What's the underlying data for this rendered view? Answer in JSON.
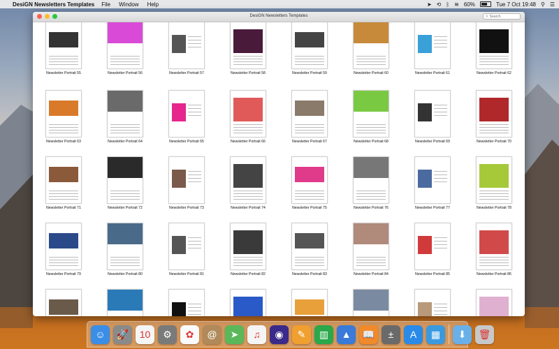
{
  "menubar": {
    "apple": "",
    "app_name": "DesiGN Newsletters Templates",
    "menus": [
      "File",
      "Window",
      "Help"
    ],
    "battery": "60%",
    "clock": "Tue 7 Oct  19:48"
  },
  "window": {
    "title": "DesiGN Newsletters Templates",
    "search_placeholder": "Search"
  },
  "templates": [
    {
      "label": "Newsletter Portrait 55",
      "accent": "#333333"
    },
    {
      "label": "Newsletter Portrait 56",
      "accent": "#d94bd6"
    },
    {
      "label": "Newsletter Portrait 57",
      "accent": "#555555"
    },
    {
      "label": "Newsletter Portrait 58",
      "accent": "#4a1a3a"
    },
    {
      "label": "Newsletter Portrait 59",
      "accent": "#444444"
    },
    {
      "label": "Newsletter Portrait 60",
      "accent": "#c78a3a"
    },
    {
      "label": "Newsletter Portrait 61",
      "accent": "#3aa0d8"
    },
    {
      "label": "Newsletter Portrait 62",
      "accent": "#111111"
    },
    {
      "label": "Newsletter Portrait 63",
      "accent": "#d97a2a"
    },
    {
      "label": "Newsletter Portrait 64",
      "accent": "#6a6a6a"
    },
    {
      "label": "Newsletter Portrait 65",
      "accent": "#e6268c"
    },
    {
      "label": "Newsletter Portrait 66",
      "accent": "#e05a5a"
    },
    {
      "label": "Newsletter Portrait 67",
      "accent": "#8a7a6a"
    },
    {
      "label": "Newsletter Portrait 68",
      "accent": "#7ac943"
    },
    {
      "label": "Newsletter Portrait 69",
      "accent": "#333333"
    },
    {
      "label": "Newsletter Portrait 70",
      "accent": "#b0282a"
    },
    {
      "label": "Newsletter Portrait 71",
      "accent": "#8a5a3a"
    },
    {
      "label": "Newsletter Portrait 72",
      "accent": "#2a2a2a"
    },
    {
      "label": "Newsletter Portrait 73",
      "accent": "#7a5a4a"
    },
    {
      "label": "Newsletter Portrait 74",
      "accent": "#444444"
    },
    {
      "label": "Newsletter Portrait 75",
      "accent": "#e03a8a"
    },
    {
      "label": "Newsletter Portrait 76",
      "accent": "#777777"
    },
    {
      "label": "Newsletter Portrait 77",
      "accent": "#4a6aa0"
    },
    {
      "label": "Newsletter Portrait 78",
      "accent": "#a6c93a"
    },
    {
      "label": "Newsletter Portrait 79",
      "accent": "#2a4a8a"
    },
    {
      "label": "Newsletter Portrait 80",
      "accent": "#4a6a8a"
    },
    {
      "label": "Newsletter Portrait 81",
      "accent": "#555555"
    },
    {
      "label": "Newsletter Portrait 82",
      "accent": "#3a3a3a"
    },
    {
      "label": "Newsletter Portrait 83",
      "accent": "#555555"
    },
    {
      "label": "Newsletter Portrait 84",
      "accent": "#b08a7a"
    },
    {
      "label": "Newsletter Portrait 85",
      "accent": "#d03a3a"
    },
    {
      "label": "Newsletter Portrait 86",
      "accent": "#d04a4a"
    },
    {
      "label": "",
      "accent": "#6a5a4a"
    },
    {
      "label": "",
      "accent": "#2a7ab8"
    },
    {
      "label": "",
      "accent": "#111111"
    },
    {
      "label": "",
      "accent": "#2a5ac8"
    },
    {
      "label": "",
      "accent": "#e8a03a"
    },
    {
      "label": "",
      "accent": "#7a8aa0"
    },
    {
      "label": "",
      "accent": "#b89a7a"
    },
    {
      "label": "",
      "accent": "#e0b0d0"
    }
  ],
  "dock": [
    {
      "name": "finder-icon",
      "glyph": "☺",
      "bg": "#3a8ee6"
    },
    {
      "name": "launchpad-icon",
      "glyph": "🚀",
      "bg": "#8a8a8a"
    },
    {
      "name": "calendar-icon",
      "glyph": "10",
      "bg": "#f5f5f5"
    },
    {
      "name": "system-preferences-icon",
      "glyph": "⚙",
      "bg": "#7a7a7a"
    },
    {
      "name": "photos-icon",
      "glyph": "✿",
      "bg": "#fafafa"
    },
    {
      "name": "contacts-icon",
      "glyph": "@",
      "bg": "#b08a5a"
    },
    {
      "name": "maps-icon",
      "glyph": "➤",
      "bg": "#5ab85a"
    },
    {
      "name": "itunes-icon",
      "glyph": "♫",
      "bg": "#f5f5f5"
    },
    {
      "name": "siri-icon",
      "glyph": "◉",
      "bg": "#3a2a8a"
    },
    {
      "name": "pages-icon",
      "glyph": "✎",
      "bg": "#f0a030"
    },
    {
      "name": "numbers-icon",
      "glyph": "▥",
      "bg": "#2aa84a"
    },
    {
      "name": "keynote-icon",
      "glyph": "▲",
      "bg": "#3a7ad8"
    },
    {
      "name": "ibooks-icon",
      "glyph": "📖",
      "bg": "#f08a2a"
    },
    {
      "name": "calculator-icon",
      "glyph": "±",
      "bg": "#6a6a6a"
    },
    {
      "name": "app-store-icon",
      "glyph": "A",
      "bg": "#2a8ae8"
    },
    {
      "name": "design-newsletters-icon",
      "glyph": "▦",
      "bg": "#3a9ae0"
    },
    {
      "name": "downloads-folder-icon",
      "glyph": "⬇",
      "bg": "#6ab0e8"
    },
    {
      "name": "trash-icon",
      "glyph": "🗑",
      "bg": "#c8c8c8"
    }
  ]
}
